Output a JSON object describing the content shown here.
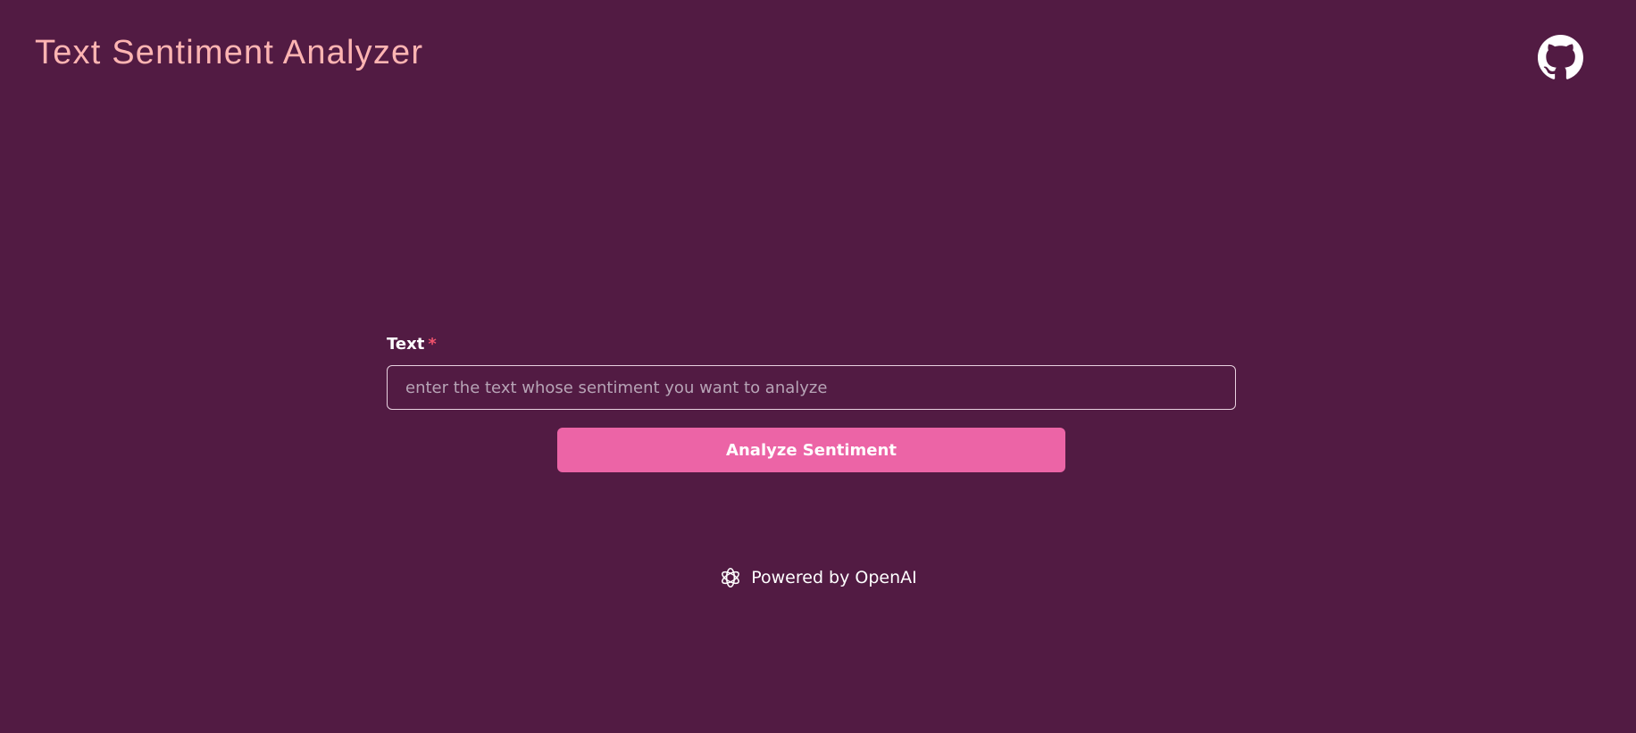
{
  "header": {
    "title": "Text Sentiment Analyzer",
    "github_icon": "github-icon"
  },
  "form": {
    "field_label": "Text",
    "required_mark": "*",
    "input_value": "",
    "input_placeholder": "enter the text whose sentiment you want to analyze",
    "submit_label": "Analyze Sentiment"
  },
  "footer": {
    "icon": "openai-icon",
    "text": "Powered by OpenAI"
  },
  "colors": {
    "background": "#521B43",
    "title": "#FDB4B2",
    "button": "#EC64A6",
    "required": "#F0526C"
  }
}
